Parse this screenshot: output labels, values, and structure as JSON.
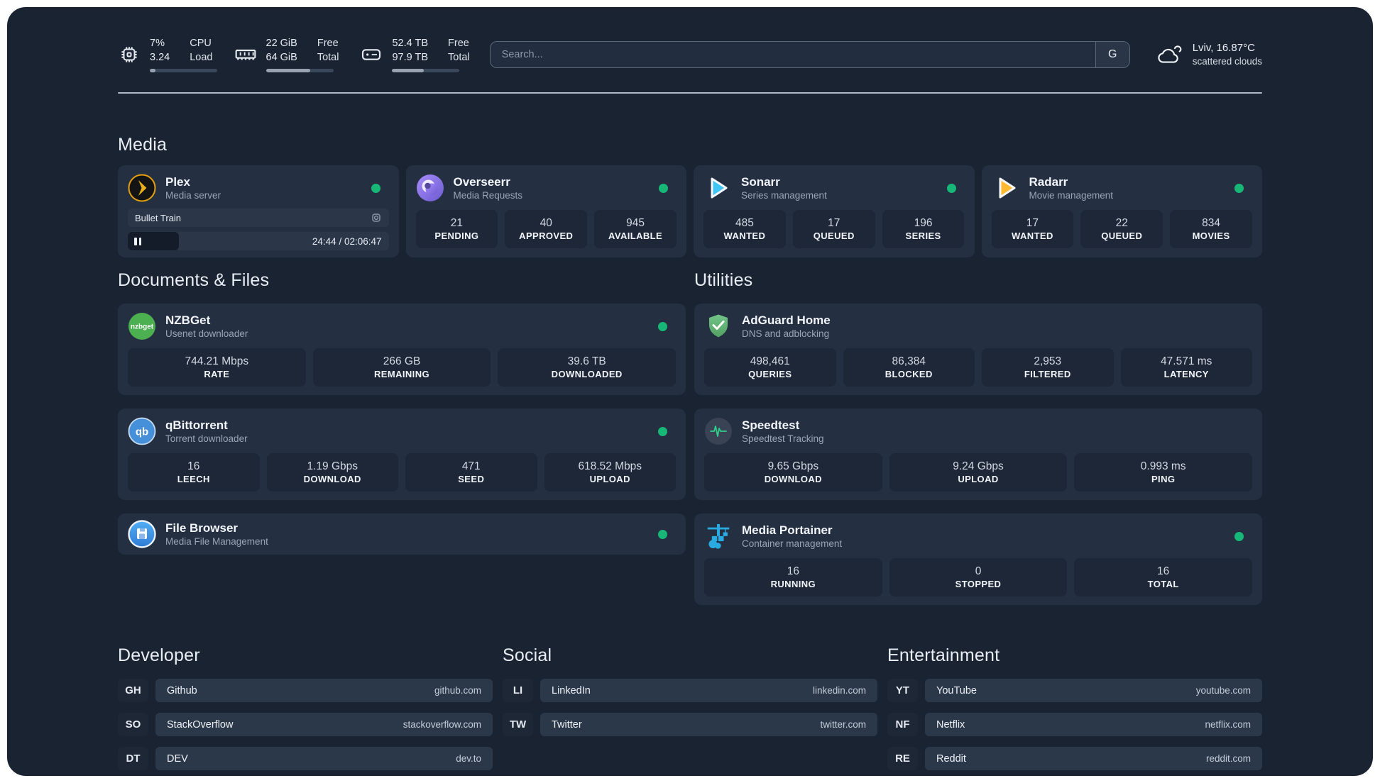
{
  "colors": {
    "status_online": "#17B877",
    "accent_plex": "#E5A00D",
    "accent_sonarr": "#41C5F2",
    "accent_radarr": "#FFB930",
    "accent_portainer": "#29ABE2"
  },
  "header": {
    "system_stats": [
      {
        "icon": "cpu-icon",
        "line1": "7%",
        "line2": "3.24",
        "label1": "CPU",
        "label2": "Load",
        "progress_pct": 8
      },
      {
        "icon": "memory-icon",
        "line1": "22 GiB",
        "line2": "64 GiB",
        "label1": "Free",
        "label2": "Total",
        "progress_pct": 66
      },
      {
        "icon": "disk-icon",
        "line1": "52.4 TB",
        "line2": "97.9 TB",
        "label1": "Free",
        "label2": "Total",
        "progress_pct": 47
      }
    ],
    "search": {
      "placeholder": "Search...",
      "engine_button": "G"
    },
    "weather": {
      "summary": "Lviv, 16.87°C",
      "condition": "scattered clouds"
    }
  },
  "sections": {
    "media": {
      "title": "Media",
      "plex": {
        "title": "Plex",
        "subtitle": "Media server",
        "now_playing": "Bullet Train",
        "progress_pct": 19.5,
        "time": "24:44 / 02:06:47"
      },
      "overseerr": {
        "title": "Overseerr",
        "subtitle": "Media Requests",
        "stats": [
          {
            "value": "21",
            "label": "PENDING"
          },
          {
            "value": "40",
            "label": "APPROVED"
          },
          {
            "value": "945",
            "label": "AVAILABLE"
          }
        ]
      },
      "sonarr": {
        "title": "Sonarr",
        "subtitle": "Series management",
        "stats": [
          {
            "value": "485",
            "label": "WANTED"
          },
          {
            "value": "17",
            "label": "QUEUED"
          },
          {
            "value": "196",
            "label": "SERIES"
          }
        ]
      },
      "radarr": {
        "title": "Radarr",
        "subtitle": "Movie management",
        "stats": [
          {
            "value": "17",
            "label": "WANTED"
          },
          {
            "value": "22",
            "label": "QUEUED"
          },
          {
            "value": "834",
            "label": "MOVIES"
          }
        ]
      }
    },
    "documents": {
      "title": "Documents & Files",
      "nzbget": {
        "title": "NZBGet",
        "subtitle": "Usenet downloader",
        "stats": [
          {
            "value": "744.21 Mbps",
            "label": "RATE"
          },
          {
            "value": "266 GB",
            "label": "REMAINING"
          },
          {
            "value": "39.6 TB",
            "label": "DOWNLOADED"
          }
        ]
      },
      "qbittorrent": {
        "title": "qBittorrent",
        "subtitle": "Torrent downloader",
        "stats": [
          {
            "value": "16",
            "label": "LEECH"
          },
          {
            "value": "1.19 Gbps",
            "label": "DOWNLOAD"
          },
          {
            "value": "471",
            "label": "SEED"
          },
          {
            "value": "618.52 Mbps",
            "label": "UPLOAD"
          }
        ]
      },
      "filebrowser": {
        "title": "File Browser",
        "subtitle": "Media File Management"
      }
    },
    "utilities": {
      "title": "Utilities",
      "adguard": {
        "title": "AdGuard Home",
        "subtitle": "DNS and adblocking",
        "stats": [
          {
            "value": "498,461",
            "label": "QUERIES"
          },
          {
            "value": "86,384",
            "label": "BLOCKED"
          },
          {
            "value": "2,953",
            "label": "FILTERED"
          },
          {
            "value": "47.571 ms",
            "label": "LATENCY"
          }
        ]
      },
      "speedtest": {
        "title": "Speedtest",
        "subtitle": "Speedtest Tracking",
        "stats": [
          {
            "value": "9.65 Gbps",
            "label": "DOWNLOAD"
          },
          {
            "value": "9.24 Gbps",
            "label": "UPLOAD"
          },
          {
            "value": "0.993 ms",
            "label": "PING"
          }
        ]
      },
      "portainer": {
        "title": "Media Portainer",
        "subtitle": "Container management",
        "stats": [
          {
            "value": "16",
            "label": "RUNNING"
          },
          {
            "value": "0",
            "label": "STOPPED"
          },
          {
            "value": "16",
            "label": "TOTAL"
          }
        ]
      }
    },
    "links": {
      "developer": {
        "title": "Developer",
        "items": [
          {
            "abbr": "GH",
            "name": "Github",
            "url": "github.com"
          },
          {
            "abbr": "SO",
            "name": "StackOverflow",
            "url": "stackoverflow.com"
          },
          {
            "abbr": "DT",
            "name": "DEV",
            "url": "dev.to"
          }
        ]
      },
      "social": {
        "title": "Social",
        "items": [
          {
            "abbr": "LI",
            "name": "LinkedIn",
            "url": "linkedin.com"
          },
          {
            "abbr": "TW",
            "name": "Twitter",
            "url": "twitter.com"
          }
        ]
      },
      "entertainment": {
        "title": "Entertainment",
        "items": [
          {
            "abbr": "YT",
            "name": "YouTube",
            "url": "youtube.com"
          },
          {
            "abbr": "NF",
            "name": "Netflix",
            "url": "netflix.com"
          },
          {
            "abbr": "RE",
            "name": "Reddit",
            "url": "reddit.com"
          }
        ]
      }
    }
  }
}
